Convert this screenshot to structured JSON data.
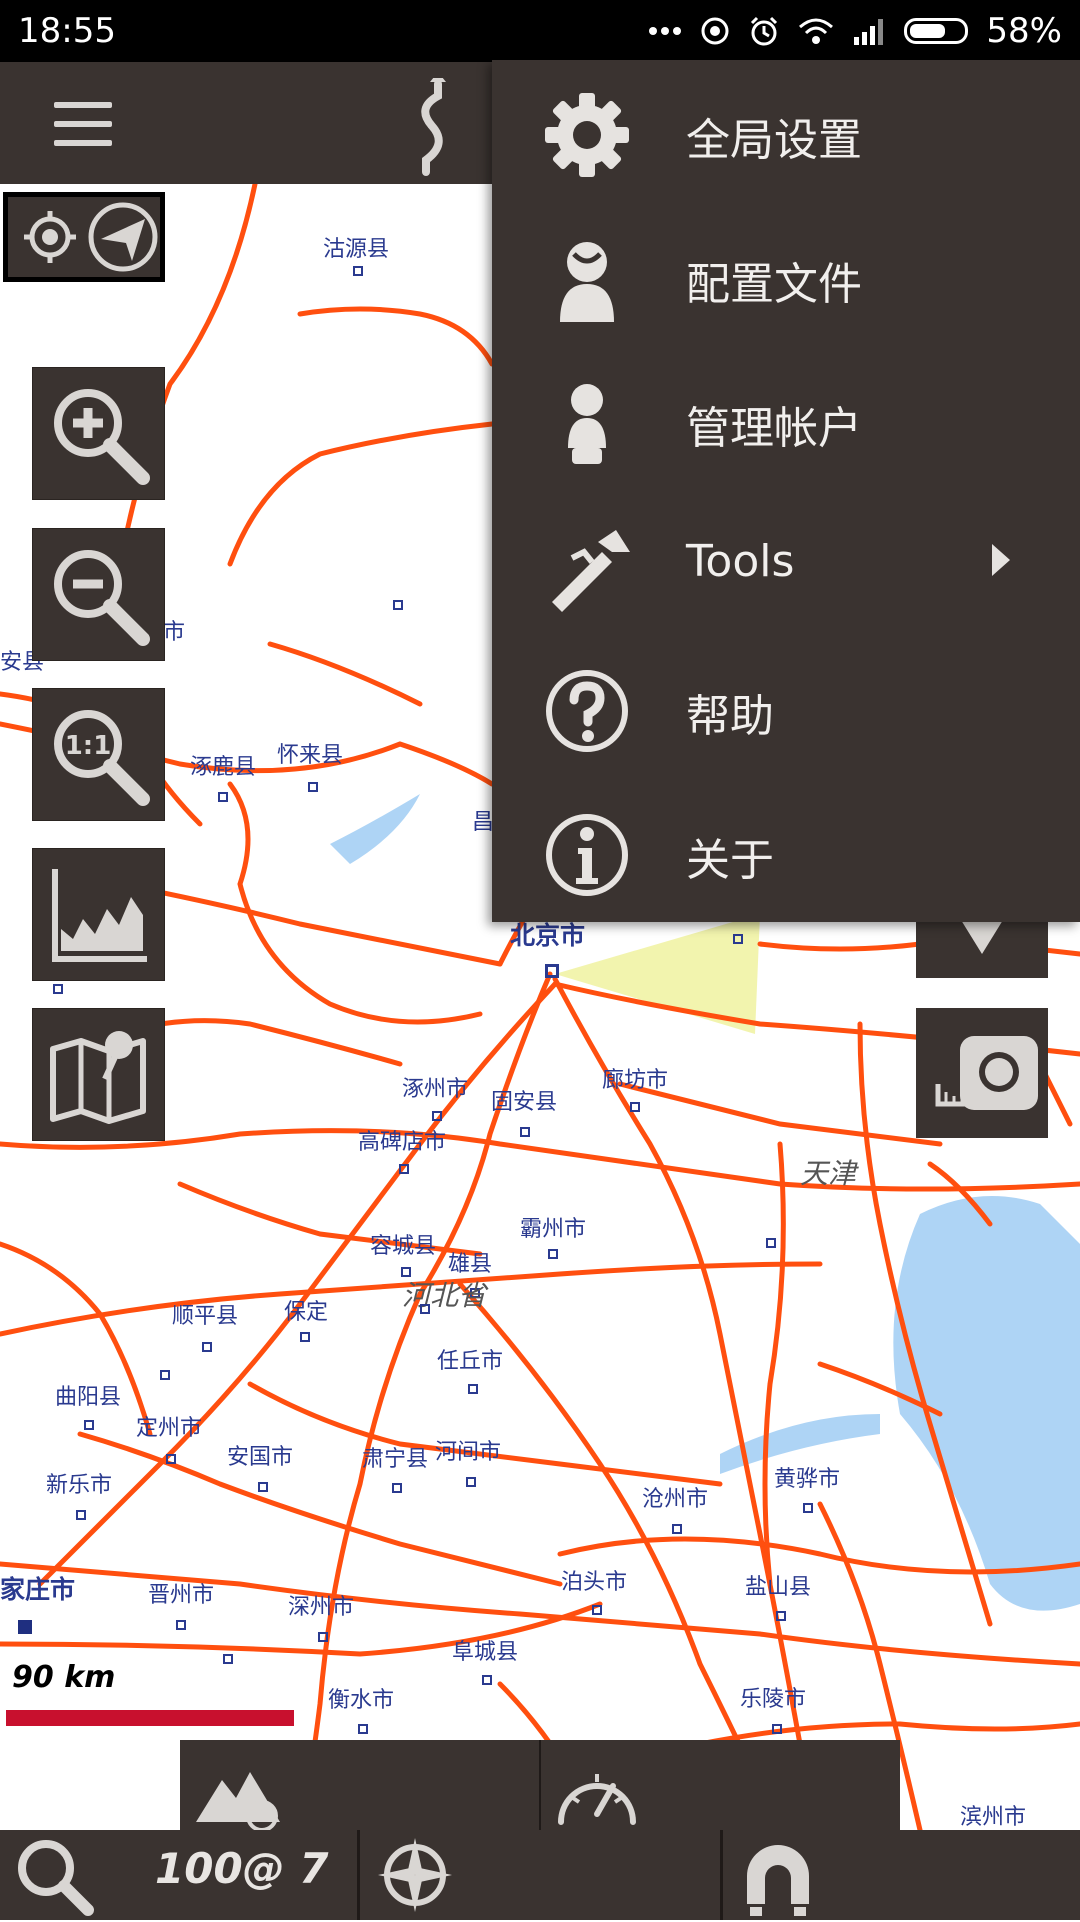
{
  "status_bar": {
    "time": "18:55",
    "battery_percent": "58%",
    "icons": [
      "more-dots-icon",
      "hotspot-icon",
      "alarm-icon",
      "wifi-icon",
      "signal-icon",
      "battery-icon"
    ]
  },
  "toolbar": {
    "menu_icon": "hamburger-menu-icon",
    "route_icon": "route-icon"
  },
  "overflow_menu": {
    "items": [
      {
        "label": "全局设置",
        "icon": "gear-icon"
      },
      {
        "label": "配置文件",
        "icon": "profile-icon"
      },
      {
        "label": "管理帐户",
        "icon": "account-icon"
      },
      {
        "label": "Tools",
        "icon": "caliper-icon",
        "has_submenu": true
      },
      {
        "label": "帮助",
        "icon": "help-icon"
      },
      {
        "label": "关于",
        "icon": "info-icon"
      }
    ]
  },
  "map": {
    "cities": [
      "沽源县",
      "怀来县",
      "涿鹿县",
      "北京市",
      "涿州市",
      "固安县",
      "廊坊市",
      "高碑店市",
      "天津",
      "容城县",
      "霸州市",
      "雄县",
      "河北省",
      "保定",
      "顺平县",
      "任丘市",
      "曲阳县",
      "定州市",
      "安国市",
      "肃宁县",
      "河间市",
      "新乐市",
      "沧州市",
      "黄骅市",
      "家庄市",
      "晋州市",
      "深州市",
      "泊头市",
      "盐山县",
      "阜城县",
      "衡水市",
      "乐陵市",
      "滨州市",
      "安县",
      "市",
      "昌"
    ]
  },
  "scale": {
    "label": "90 km"
  },
  "bottom_bar": {
    "zoom_label": "100@ 7"
  },
  "colors": {
    "panel_bg": "#3a3330",
    "road": "#ff4f0f",
    "water": "#aed4f5",
    "scalebar": "#c8102e",
    "city_text": "#2a3a8f"
  }
}
